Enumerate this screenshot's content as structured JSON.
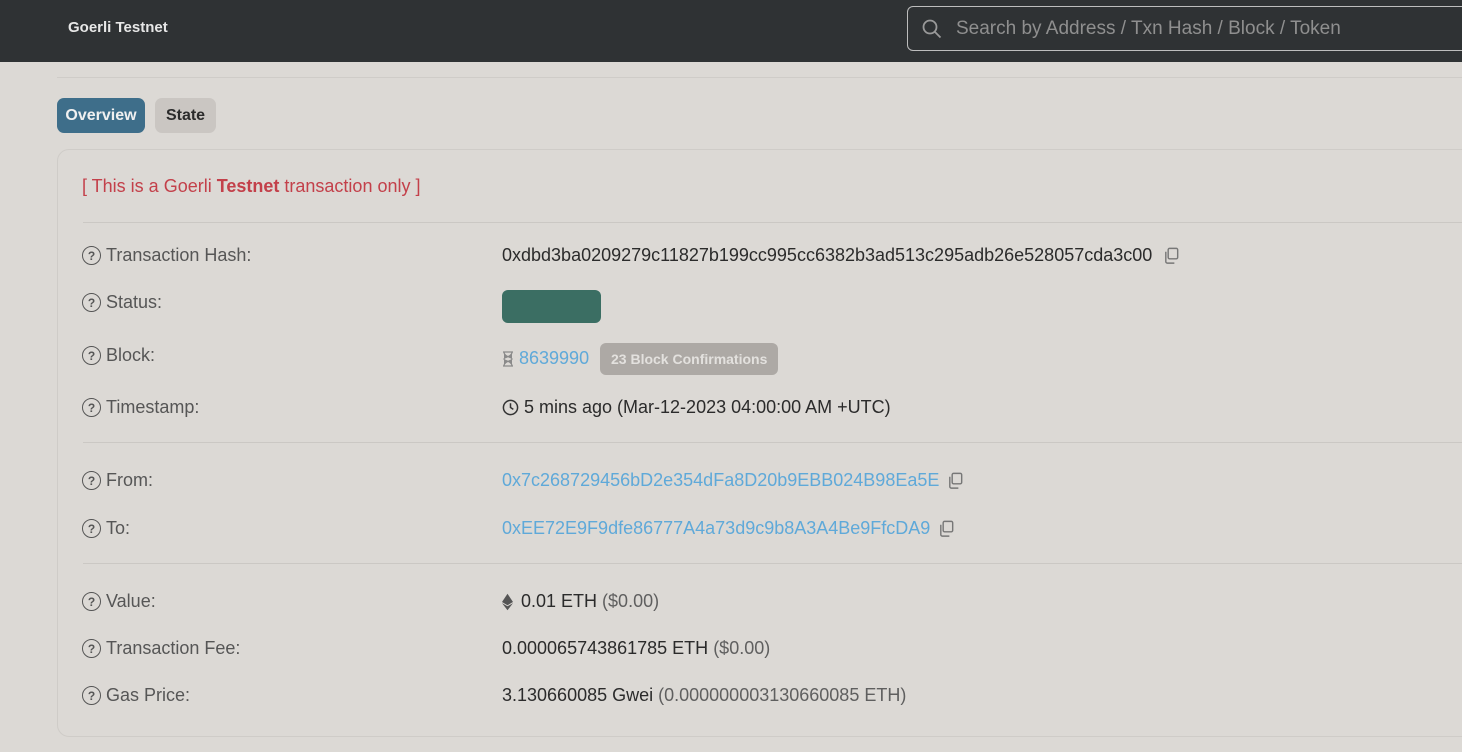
{
  "header": {
    "brand": "Goerli Testnet",
    "search_placeholder": "Search by Address / Txn Hash / Block / Token"
  },
  "tabs": [
    {
      "label": "Overview",
      "active": true
    },
    {
      "label": "State",
      "active": false
    }
  ],
  "notice": {
    "prefix": "[ This is a Goerli ",
    "bold": "Testnet",
    "suffix": " transaction only ]"
  },
  "fields": {
    "tx_hash": {
      "label": "Transaction Hash:",
      "value": "0xdbd3ba0209279c11827b199cc995cc6382b3ad513c295adb26e528057cda3c00"
    },
    "status": {
      "label": "Status:"
    },
    "block": {
      "label": "Block:",
      "value": "8639990",
      "confirmations": "23 Block Confirmations"
    },
    "timestamp": {
      "label": "Timestamp:",
      "value": "5 mins ago (Mar-12-2023 04:00:00 AM +UTC)"
    },
    "from": {
      "label": "From:",
      "value": "0x7c268729456bD2e354dFa8D20b9EBB024B98Ea5E"
    },
    "to": {
      "label": "To:",
      "value": "0xEE72E9F9dfe86777A4a73d9c9b8A3A4Be9FfcDA9"
    },
    "value": {
      "label": "Value:",
      "amount": "0.01 ETH",
      "usd": "($0.00)"
    },
    "fee": {
      "label": "Transaction Fee:",
      "amount": "0.000065743861785 ETH",
      "usd": "($0.00)"
    },
    "gas_price": {
      "label": "Gas Price:",
      "amount": "3.130660085 Gwei",
      "eth": "(0.000000003130660085 ETH)"
    }
  },
  "colors": {
    "topbar": "#2f3234",
    "active_tab": "#3e6e8a",
    "status_badge": "#3b6e63",
    "notice": "#c3404a",
    "link": "#5fa9d9"
  }
}
